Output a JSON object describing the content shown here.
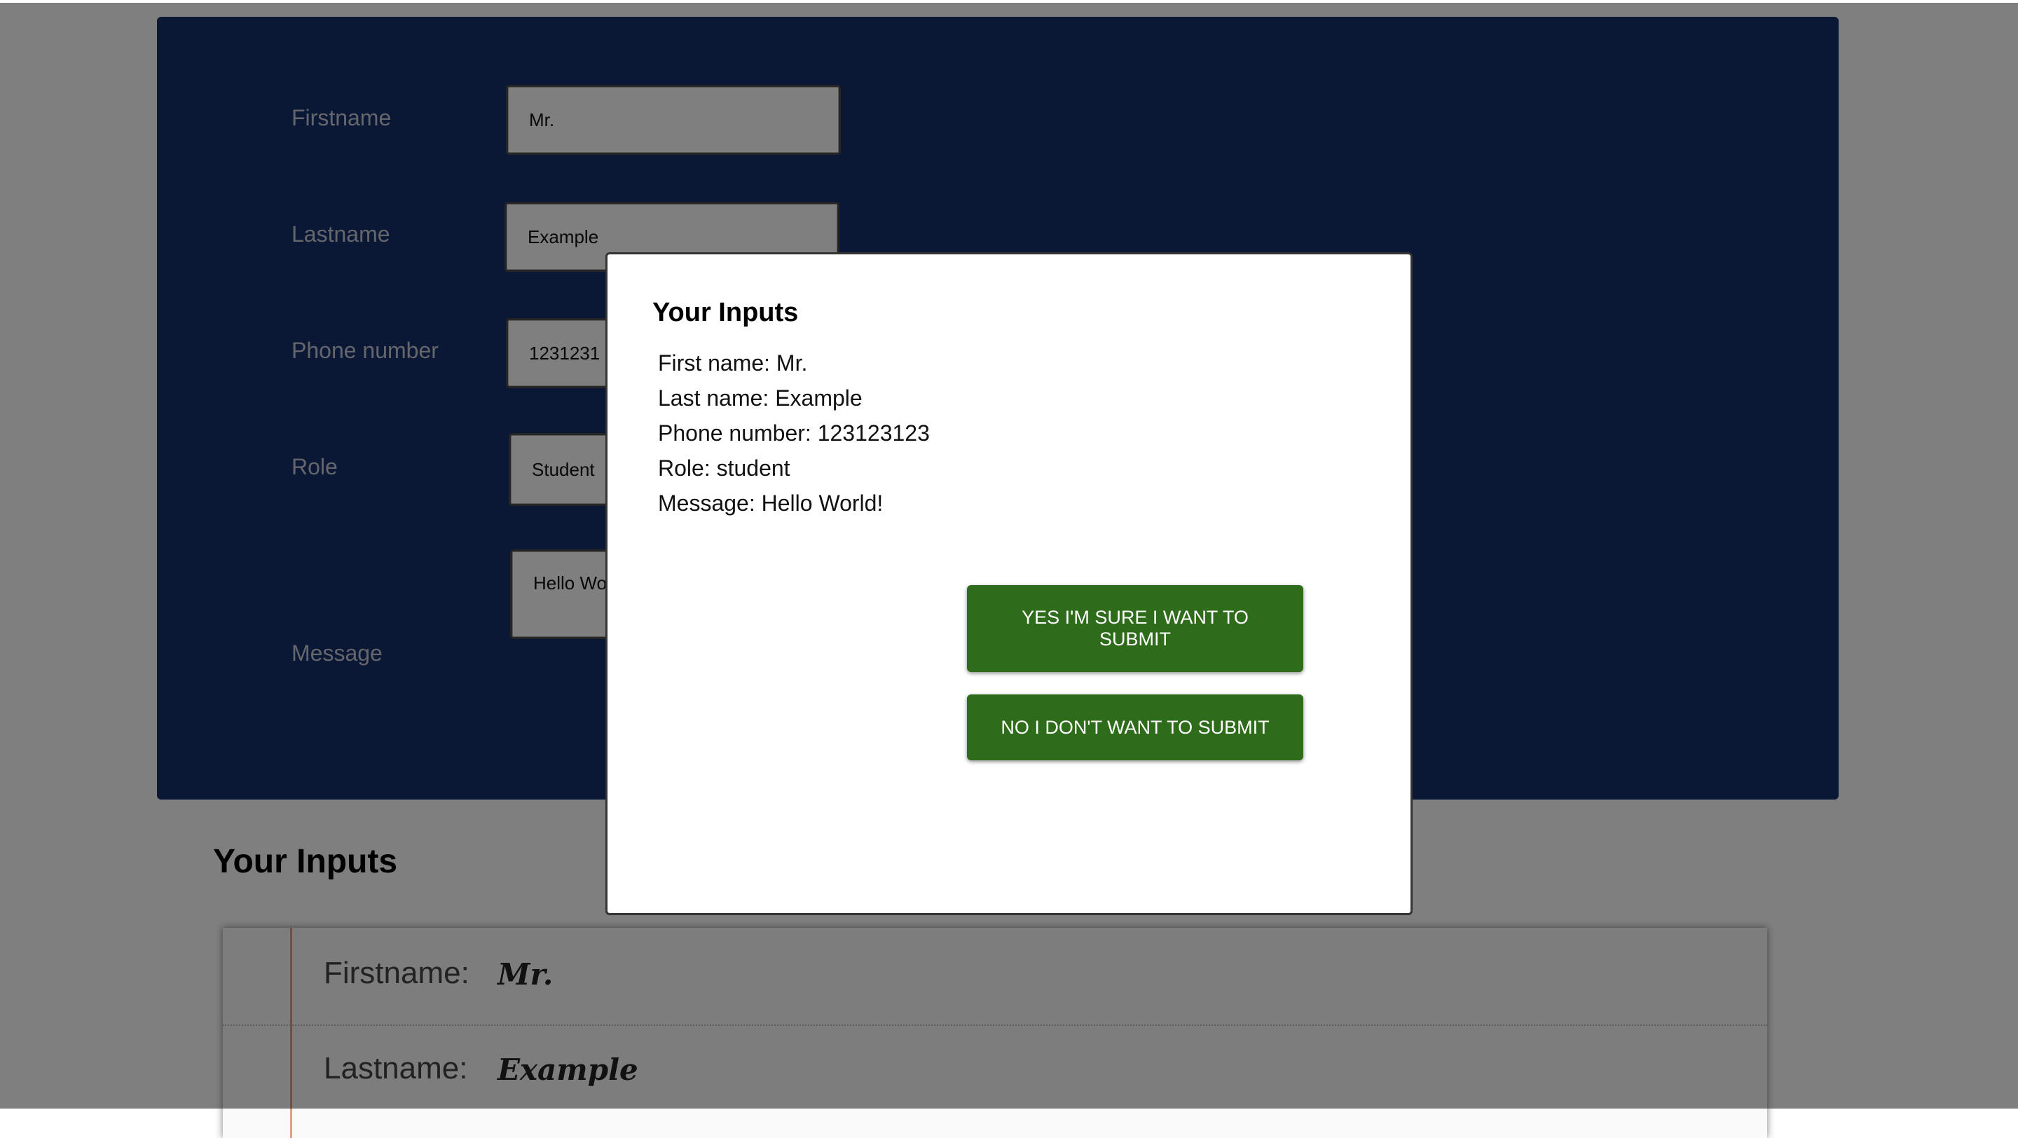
{
  "form": {
    "firstname_label": "Firstname",
    "firstname_value": "Mr.",
    "lastname_label": "Lastname",
    "lastname_value": "Example",
    "phone_label": "Phone number",
    "phone_value": "1231231",
    "role_label": "Role",
    "role_value": "Student",
    "message_label": "Message",
    "message_value": "Hello Wo"
  },
  "results": {
    "title": "Your Inputs",
    "rows": [
      {
        "label": "Firstname:",
        "value": "Mr."
      },
      {
        "label": "Lastname:",
        "value": "Example"
      }
    ]
  },
  "modal": {
    "title": "Your Inputs",
    "lines": [
      "First name: Mr.",
      "Last name: Example",
      "Phone number: 123123123",
      "Role: student",
      "Message: Hello World!"
    ],
    "confirm_label": "YES I'M SURE I WANT TO SUBMIT",
    "cancel_label": "NO I DON'T WANT TO SUBMIT"
  },
  "colors": {
    "card_bg": "#152e6a",
    "button_green": "#2e6b1a",
    "overlay": "rgba(0,0,0,0.5)"
  }
}
